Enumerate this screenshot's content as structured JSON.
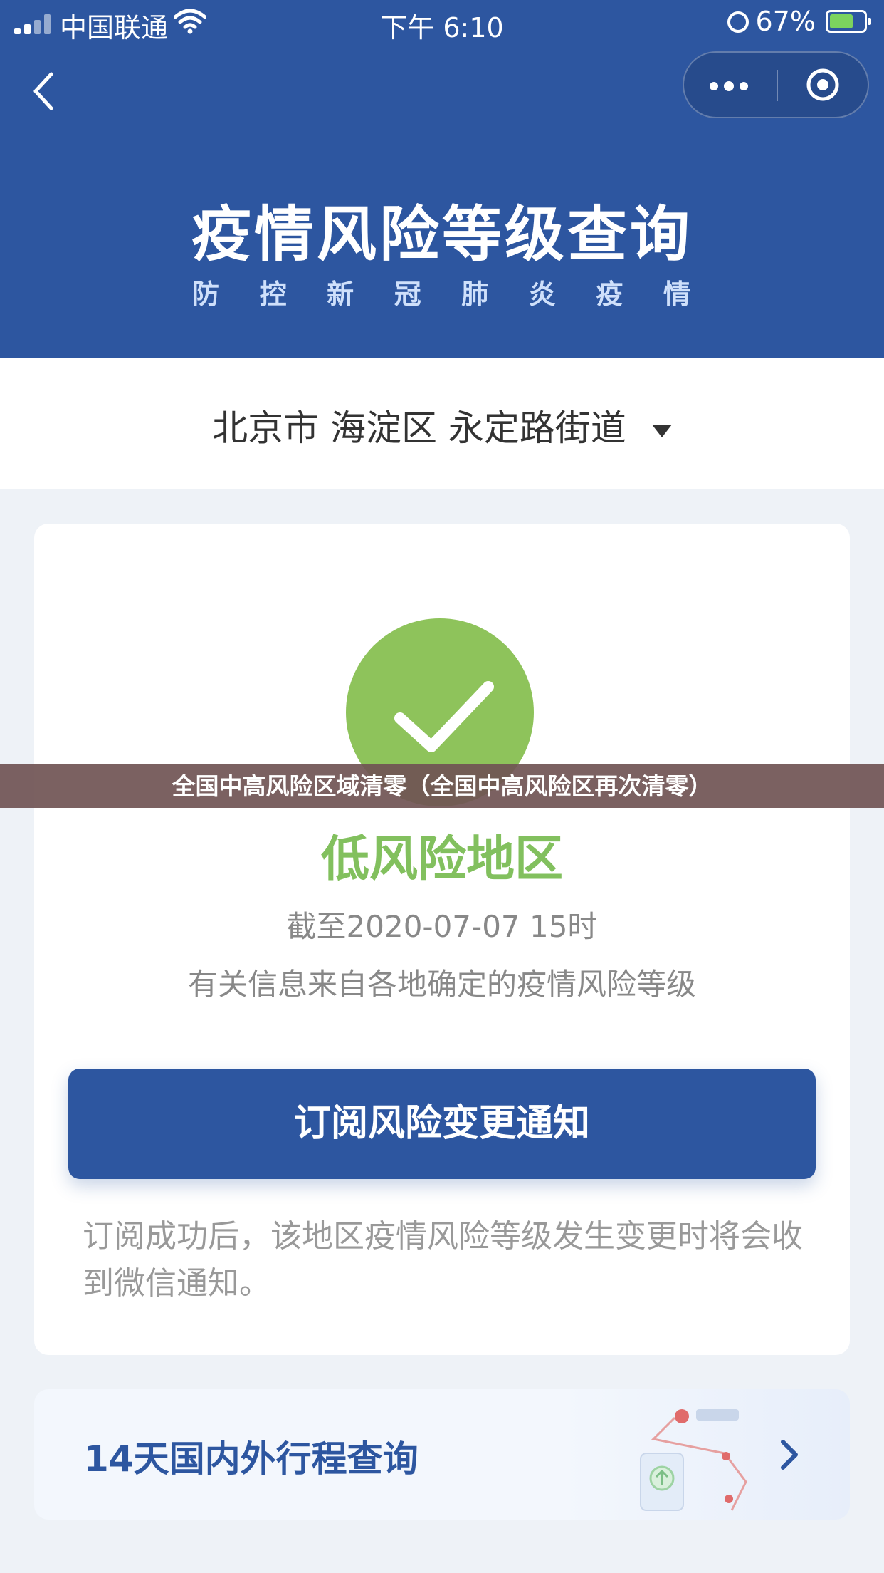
{
  "status_bar": {
    "carrier": "中国联通",
    "time": "下午 6:10",
    "battery": "67%"
  },
  "header": {
    "title": "疫情风险等级查询",
    "subtitle": [
      "防",
      "控",
      "新",
      "冠",
      "肺",
      "炎",
      "疫",
      "情"
    ]
  },
  "location": {
    "value": "北京市 海淀区 永定路街道"
  },
  "result": {
    "risk_level": "低风险地区",
    "as_of": "截至2020-07-07 15时",
    "source": "有关信息来自各地确定的疫情风险等级",
    "subscribe_label": "订阅风险变更通知",
    "note": "订阅成功后，该地区疫情风险等级发生变更时将会收到微信通知。"
  },
  "travel": {
    "label": "14天国内外行程查询"
  },
  "overlay": {
    "banner_text": "全国中高风险区域清零（全国中高风险区再次清零）"
  },
  "colors": {
    "brand_blue": "#2d56a0",
    "low_risk_green": "#8ec35b"
  },
  "icons": [
    "back-icon",
    "more-icon",
    "close-icon",
    "check-icon",
    "caret-down-icon",
    "chevron-right-icon"
  ]
}
